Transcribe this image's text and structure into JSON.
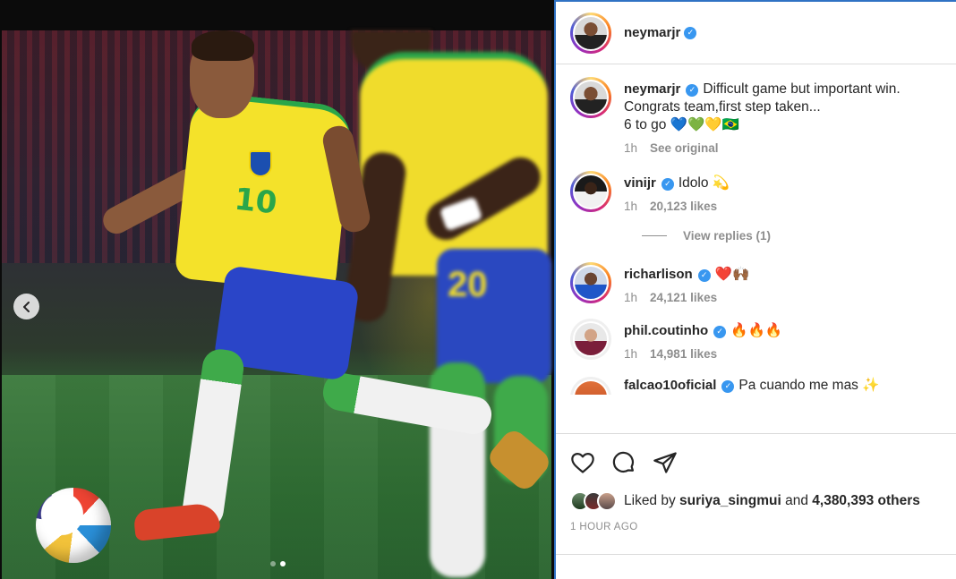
{
  "post": {
    "author": "neymarjr",
    "verified_icon": "verified-badge-icon",
    "carousel": {
      "total": 2,
      "active": 2,
      "prev_icon": "chevron-left-icon"
    }
  },
  "caption": {
    "username": "neymarjr",
    "text_line1": "Difficult game but important win.",
    "text_line2": "Congrats team,first step taken...",
    "text_line3": "6 to go 💙💚💛🇧🇷",
    "time": "1h",
    "see_original": "See original"
  },
  "comments": [
    {
      "username": "vinijr",
      "text": "Idolo 💫",
      "time": "1h",
      "likes": "20,123 likes"
    },
    {
      "username": "richarlison",
      "text": "❤️🙌🏾",
      "time": "1h",
      "likes": "24,121 likes"
    },
    {
      "username": "phil.coutinho",
      "text": "🔥🔥🔥",
      "time": "1h",
      "likes": "14,981 likes"
    },
    {
      "username": "falcao10oficial",
      "text": "Pa cuando me mas ✨"
    }
  ],
  "view_replies": "View replies (1)",
  "actions": {
    "like_icon": "heart-icon",
    "comment_icon": "comment-bubble-icon",
    "share_icon": "paper-plane-icon"
  },
  "likes": {
    "prefix": "Liked by",
    "user": "suriya_singmui",
    "and": "and",
    "others": "4,380,393 others"
  },
  "timestamp": "1 HOUR AGO",
  "colors": {
    "accent": "#3897f0",
    "link_border": "#2f72c4",
    "text": "#262626",
    "muted": "#8e8e8e"
  }
}
